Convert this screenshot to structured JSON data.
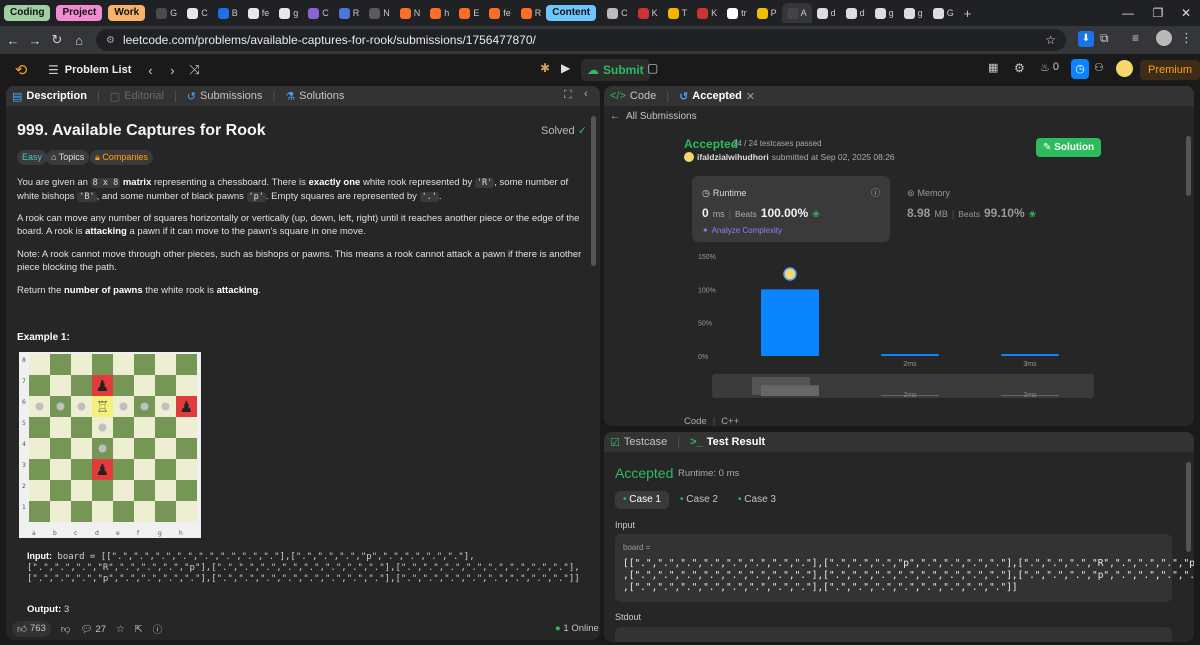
{
  "browser": {
    "tab_groups": [
      {
        "label": "Coding",
        "color": "#9ed0a3"
      },
      {
        "label": "Project",
        "color": "#f28bd1"
      },
      {
        "label": "Work",
        "color": "#f6b26b"
      }
    ],
    "tabs": [
      "G",
      "C",
      "B",
      "fe",
      "g",
      "C",
      "R",
      "N",
      "N",
      "h",
      "E",
      "fe",
      "R"
    ],
    "content_group": {
      "label": "Content",
      "color": "#6ec6ff"
    },
    "tabs_after": [
      "C",
      "K",
      "T",
      "K",
      "tr",
      "P",
      "A",
      "d",
      "d",
      "g",
      "g",
      "G"
    ],
    "new_tab": "+",
    "url": "leetcode.com/problems/available-captures-for-rook/submissions/1756477870/"
  },
  "topbar": {
    "problem_list_label": "Problem List",
    "submit_label": "Submit",
    "streak_count": "0",
    "premium_label": "Premium"
  },
  "left": {
    "tabs": {
      "description": "Description",
      "editorial": "Editorial",
      "submissions": "Submissions",
      "solutions": "Solutions"
    },
    "title": "999. Available Captures for Rook",
    "solved": "Solved",
    "chips": {
      "easy": "Easy",
      "topics": "Topics",
      "companies": "Companies"
    },
    "p1": {
      "a": "You are given an ",
      "code1": "8 x 8",
      "b": " matrix",
      "c": " representing a chessboard. There is ",
      "d": "exactly one",
      "e": " white rook represented by ",
      "code2": "'R'",
      "f": ", some number of white bishops ",
      "code3": "'B'",
      "g": ", and some number of black pawns ",
      "code4": "'p'",
      "h": ". Empty squares are represented by ",
      "code5": "'.'",
      "i": "."
    },
    "p2": {
      "a": "A rook can move any number of squares horizontally or vertically (up, down, left, right) until it reaches another piece ",
      "b": "or",
      "c": " the edge of the board. A rook is ",
      "d": "attacking",
      "e": " a pawn if it can move to the pawn's square in one move."
    },
    "p3": "Note: A rook cannot move through other pieces, such as bishops or pawns. This means a rook cannot attack a pawn if there is another piece blocking the path.",
    "p4": {
      "a": "Return the ",
      "b": "number of pawns",
      "c": " the white rook is ",
      "d": "attacking",
      "e": "."
    },
    "example_title": "Example 1:",
    "board_files": [
      "a",
      "b",
      "c",
      "d",
      "e",
      "f",
      "g",
      "h"
    ],
    "board_ranks": [
      "8",
      "7",
      "6",
      "5",
      "4",
      "3",
      "2",
      "1"
    ],
    "input_label": "Input:",
    "input_lines": [
      "board = [[\".\",\".\",\".\",\".\",\".\",\".\",\".\",\".\"],[\".\",\".\",\".\",\"p\",\".\",\".\",\".\",\".\"],",
      "[\".\",\".\",\".\",\"R\",\".\",\".\",\".\",\"p\"],[\".\",\".\",\".\",\".\",\".\",\".\",\".\",\".\"],[\".\",\".\",\".\",\".\",\".\",\".\",\".\",\".\"],",
      "[\".\",\".\",\".\",\"p\",\".\",\".\",\".\",\".\"],[\".\",\".\",\".\",\".\",\".\",\".\",\".\",\".\"],[\".\",\".\",\".\",\".\",\".\",\".\",\".\",\".\"]]"
    ],
    "output_label": "Output:",
    "output_value": "3",
    "likes": "763",
    "comments": "27",
    "online": "1 Online"
  },
  "right_top": {
    "tabs": {
      "code": "Code",
      "accepted": "Accepted"
    },
    "all_submissions": "All Submissions",
    "status": "Accepted",
    "testcases": "24 / 24 testcases passed",
    "user": "ifaldzialwihudhori",
    "submitted_at": "submitted at Sep 02, 2025 08:26",
    "solution_label": "Solution",
    "runtime_label": "Runtime",
    "runtime_value": "0",
    "runtime_unit": "ms",
    "beats_label": "Beats",
    "runtime_beats": "100.00%",
    "analyze_label": "Analyze Complexity",
    "memory_label": "Memory",
    "memory_value": "8.98",
    "memory_unit": "MB",
    "memory_beats": "99.10%",
    "code_lang_label": "Code",
    "code_lang": "C++"
  },
  "chart_data": {
    "type": "bar",
    "categories": [
      "0ms",
      "2ms",
      "3ms"
    ],
    "x_labels": [
      "",
      "2ms",
      "3ms"
    ],
    "values": [
      100,
      2,
      2
    ],
    "highlight_index": 0,
    "yticks": [
      "150%",
      "100%",
      "50%",
      "0%"
    ],
    "ylim": [
      0,
      150
    ],
    "colors": {
      "bar": "#0a84ff",
      "grid": "#3a3a3a"
    }
  },
  "right_bottom": {
    "tabs": {
      "testcase": "Testcase",
      "result": "Test Result"
    },
    "status": "Accepted",
    "runtime": "Runtime: 0 ms",
    "cases": [
      "Case 1",
      "Case 2",
      "Case 3"
    ],
    "input_label": "Input",
    "board_label": "board =",
    "board_lines": [
      "[[\".\",\".\",\".\",\".\",\".\",\".\",\".\",\".\"],[\".\",\".\",\".\",\"p\",\".\",\".\",\".\",\".\"],[\".\",\".\",\".\",\"R\",\".\",\".\",\".\",\"p\"]",
      ",[\".\",\".\",\".\",\".\",\".\",\".\",\".\",\".\"],[\".\",\".\",\".\",\".\",\".\",\".\",\".\",\".\"],[\".\",\".\",\".\",\"p\",\".\",\".\",\".\",\".\"]",
      ",[\".\",\".\",\".\",\".\",\".\",\".\",\".\",\".\"],[\".\",\".\",\".\",\".\",\".\",\".\",\".\",\".\"]]"
    ],
    "stdout_label": "Stdout"
  }
}
